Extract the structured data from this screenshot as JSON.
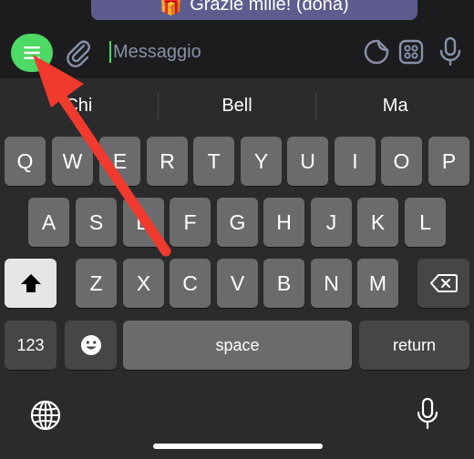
{
  "chat": {
    "last_message": "Grazie mille! (donà)",
    "message_emoji": "🎁"
  },
  "input": {
    "placeholder": "Messaggio"
  },
  "icons": {
    "menu": "menu-icon",
    "attach": "paperclip-icon",
    "sticker": "sticker-icon",
    "emoji_grid": "emoji-grid-icon",
    "microphone": "microphone-icon",
    "globe": "globe-icon",
    "dictation": "dictation-microphone-icon",
    "shift": "shift-icon",
    "backspace": "backspace-icon",
    "emoji_key": "smiley-icon"
  },
  "suggestions": [
    "Chi",
    "Bell",
    "Ma"
  ],
  "keyboard": {
    "row1": [
      "Q",
      "W",
      "E",
      "R",
      "T",
      "Y",
      "U",
      "I",
      "O",
      "P"
    ],
    "row2": [
      "A",
      "S",
      "D",
      "F",
      "G",
      "H",
      "J",
      "K",
      "L"
    ],
    "row3": [
      "Z",
      "X",
      "C",
      "V",
      "B",
      "N",
      "M"
    ],
    "numbers_label": "123",
    "space_label": "space",
    "return_label": "return"
  },
  "colors": {
    "accent": "#4cd964",
    "annotation_arrow": "#f03a2e",
    "bubble": "#5e5c8e"
  }
}
